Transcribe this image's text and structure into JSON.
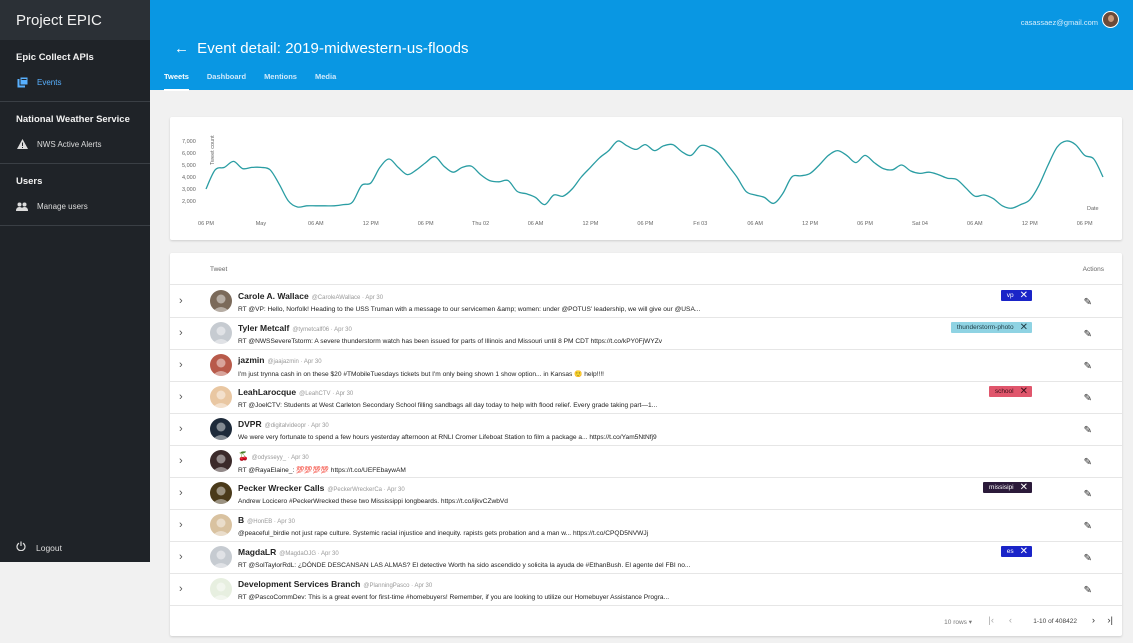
{
  "app": {
    "title": "Project EPIC"
  },
  "sidebar": {
    "sections": [
      {
        "title": "Epic Collect APIs",
        "items": [
          {
            "label": "Events",
            "icon": "collection-icon",
            "active": true
          }
        ]
      },
      {
        "title": "National Weather Service",
        "items": [
          {
            "label": "NWS Active Alerts",
            "icon": "warning-icon",
            "active": false
          }
        ]
      },
      {
        "title": "Users",
        "items": [
          {
            "label": "Manage users",
            "icon": "group-icon",
            "active": false
          }
        ]
      }
    ],
    "logout_label": "Logout"
  },
  "header": {
    "user_email": "casassaez@gmail.com",
    "title": "Event detail: 2019-midwestern-us-floods",
    "tabs": [
      "Tweets",
      "Dashboard",
      "Mentions",
      "Media"
    ],
    "active_tab": "Tweets"
  },
  "chart_data": {
    "type": "line",
    "ylabel": "Tweet count",
    "xlabel": "Date",
    "yticks": [
      "7,000",
      "6,000",
      "5,000",
      "4,000",
      "3,000",
      "2,000"
    ],
    "ylim": [
      1000,
      7500
    ],
    "xticks": [
      "06 PM",
      "May",
      "06 AM",
      "12 PM",
      "06 PM",
      "Thu 02",
      "06 AM",
      "12 PM",
      "06 PM",
      "Fri 03",
      "06 AM",
      "12 PM",
      "06 PM",
      "Sat 04",
      "06 AM",
      "12 PM",
      "06 PM"
    ],
    "x_hours": [
      0,
      6,
      12,
      18,
      24,
      30,
      36,
      42,
      48,
      54,
      60,
      66,
      72,
      78,
      84,
      90,
      96
    ],
    "series": [
      {
        "points": [
          [
            0,
            3000
          ],
          [
            1,
            4600
          ],
          [
            2,
            4800
          ],
          [
            3,
            5300
          ],
          [
            4,
            4700
          ],
          [
            5,
            4800
          ],
          [
            6,
            4800
          ],
          [
            7,
            4600
          ],
          [
            8,
            3400
          ],
          [
            9,
            2000
          ],
          [
            10,
            1500
          ],
          [
            11,
            1600
          ],
          [
            12,
            1600
          ],
          [
            13,
            1600
          ],
          [
            14,
            1600
          ],
          [
            15,
            1700
          ],
          [
            16,
            1900
          ],
          [
            17,
            3300
          ],
          [
            18,
            3500
          ],
          [
            19,
            4800
          ],
          [
            20,
            5500
          ],
          [
            21,
            4800
          ],
          [
            22,
            4200
          ],
          [
            23,
            4600
          ],
          [
            24,
            5200
          ],
          [
            25,
            5700
          ],
          [
            26,
            4900
          ],
          [
            27,
            4400
          ],
          [
            28,
            4800
          ],
          [
            29,
            4900
          ],
          [
            30,
            4200
          ],
          [
            31,
            3700
          ],
          [
            32,
            3600
          ],
          [
            33,
            3700
          ],
          [
            34,
            2800
          ],
          [
            35,
            2600
          ],
          [
            36,
            2300
          ],
          [
            37,
            1700
          ],
          [
            38,
            2500
          ],
          [
            39,
            2400
          ],
          [
            40,
            3000
          ],
          [
            41,
            4000
          ],
          [
            42,
            4800
          ],
          [
            43,
            5600
          ],
          [
            44,
            6200
          ],
          [
            45,
            7000
          ],
          [
            46,
            6600
          ],
          [
            47,
            6300
          ],
          [
            48,
            6700
          ],
          [
            49,
            6200
          ],
          [
            50,
            6600
          ],
          [
            51,
            6700
          ],
          [
            52,
            6100
          ],
          [
            53,
            5800
          ],
          [
            54,
            6600
          ],
          [
            55,
            6500
          ],
          [
            56,
            6000
          ],
          [
            57,
            5000
          ],
          [
            58,
            4000
          ],
          [
            59,
            2800
          ],
          [
            60,
            2500
          ],
          [
            61,
            2300
          ],
          [
            62,
            1800
          ],
          [
            63,
            2600
          ],
          [
            64,
            4000
          ],
          [
            65,
            4100
          ],
          [
            66,
            4300
          ],
          [
            67,
            5000
          ],
          [
            68,
            5800
          ],
          [
            69,
            6200
          ],
          [
            70,
            5800
          ],
          [
            71,
            5200
          ],
          [
            72,
            5800
          ],
          [
            73,
            5200
          ],
          [
            74,
            4700
          ],
          [
            75,
            4600
          ],
          [
            76,
            5000
          ],
          [
            77,
            4500
          ],
          [
            78,
            4300
          ],
          [
            79,
            4400
          ],
          [
            80,
            4200
          ],
          [
            81,
            3900
          ],
          [
            82,
            3800
          ],
          [
            83,
            3100
          ],
          [
            84,
            2400
          ],
          [
            85,
            2500
          ],
          [
            86,
            2200
          ],
          [
            87,
            1600
          ],
          [
            88,
            1400
          ],
          [
            89,
            1700
          ],
          [
            90,
            2100
          ],
          [
            91,
            3300
          ],
          [
            92,
            5000
          ],
          [
            93,
            6500
          ],
          [
            94,
            7000
          ],
          [
            95,
            6700
          ],
          [
            96,
            5800
          ],
          [
            97,
            5500
          ],
          [
            98,
            4000
          ]
        ]
      }
    ]
  },
  "table": {
    "headers": {
      "tweet": "Tweet",
      "actions": "Actions"
    },
    "rows": [
      {
        "name": "Carole A. Wallace",
        "handle": "@CaroleAWallace",
        "date": "Apr 30",
        "text": "RT @VP: Hello, Norfolk! Heading to the USS Truman with a message to our servicemen &amp; women: under @POTUS' leadership, we will give our @USA...",
        "tag": "vp",
        "tag_color": "#1a24c8",
        "tag_text_color": "#ffffff",
        "avatar_color": "#7b6a5a"
      },
      {
        "name": "Tyler Metcalf",
        "handle": "@tymetcalf06",
        "date": "Apr 30",
        "text": "RT @NWSSevereTstorm: A severe thunderstorm watch has been issued for parts of Illinois and Missouri until 8 PM CDT https://t.co/kPY0FjWYZv",
        "tag": "thunderstorm-photo",
        "tag_color": "#8fd3e3",
        "tag_text_color": "#1f3b44",
        "avatar_color": "#c6cbd1"
      },
      {
        "name": "jazmin",
        "handle": "@jaajazmin",
        "date": "Apr 30",
        "text": "I'm just trynna cash in on these $20 #TMobileTuesdays tickets but I'm only being shown 1 show option... in Kansas 🙂 help!!!!",
        "tag": "",
        "tag_color": "",
        "tag_text_color": "",
        "avatar_color": "#b85a4a"
      },
      {
        "name": "LeahLarocque",
        "handle": "@LeahCTV",
        "date": "Apr 30",
        "text": "RT @JoelCTV: Students at West Carleton Secondary School filling sandbags all day today to help with flood relief. Every grade taking part—1...",
        "tag": "school",
        "tag_color": "#e0566c",
        "tag_text_color": "#3a0f18",
        "avatar_color": "#e9c7a2"
      },
      {
        "name": "DVPR",
        "handle": "@digitalvideopr",
        "date": "Apr 30",
        "text": "We were very fortunate to spend a few hours yesterday afternoon at RNLI Cromer Lifeboat Station to film a package a... https://t.co/Yam5NtNfj9",
        "tag": "",
        "tag_color": "",
        "tag_text_color": "",
        "avatar_color": "#1d2a3a"
      },
      {
        "name": "🍒",
        "handle": "@odysseyy_",
        "date": "Apr 30",
        "text": "RT @RayaElaine_: 💯💯💯💯 https://t.co/UEFEbaywAM",
        "tag": "",
        "tag_color": "",
        "tag_text_color": "",
        "avatar_color": "#3b2a2a"
      },
      {
        "name": "Pecker Wrecker Calls",
        "handle": "@PeckerWreckerCa",
        "date": "Apr 30",
        "text": "Andrew Locicero #PeckerWrecked these two Mississippi longbeards. https://t.co/ijkvCZwbVd",
        "tag": "missisipi",
        "tag_color": "#2b1a3a",
        "tag_text_color": "#ffffff",
        "avatar_color": "#4a3a1a"
      },
      {
        "name": "B",
        "handle": "@HonEB",
        "date": "Apr 30",
        "text": "@peaceful_birdie not just rape culture. Systemic racial injustice and inequity. rapists gets probation and a man w... https://t.co/CPQD5NVWJj",
        "tag": "",
        "tag_color": "",
        "tag_text_color": "",
        "avatar_color": "#d9c2a0"
      },
      {
        "name": "MagdaLR",
        "handle": "@MagdaOJG",
        "date": "Apr 30",
        "text": "RT @SolTaylorRdL: ¿DÓNDE DESCANSAN LAS ALMAS? El detective Worth ha sido ascendido y solicita la ayuda de #EthanBush. El agente del FBI no...",
        "tag": "es",
        "tag_color": "#1a24c8",
        "tag_text_color": "#ffffff",
        "avatar_color": "#c6cbd1"
      },
      {
        "name": "Development Services Branch",
        "handle": "@PlanningPasco",
        "date": "Apr 30",
        "text": "RT @PascoCommDev: This is a great event for first-time #homebuyers! Remember, if you are looking to utilize our Homebuyer Assistance Progra...",
        "tag": "",
        "tag_color": "",
        "tag_text_color": "",
        "avatar_color": "#e7efe0"
      }
    ],
    "footer": {
      "rows_per_page": "10 rows",
      "range": "1-10 of 408422"
    }
  }
}
